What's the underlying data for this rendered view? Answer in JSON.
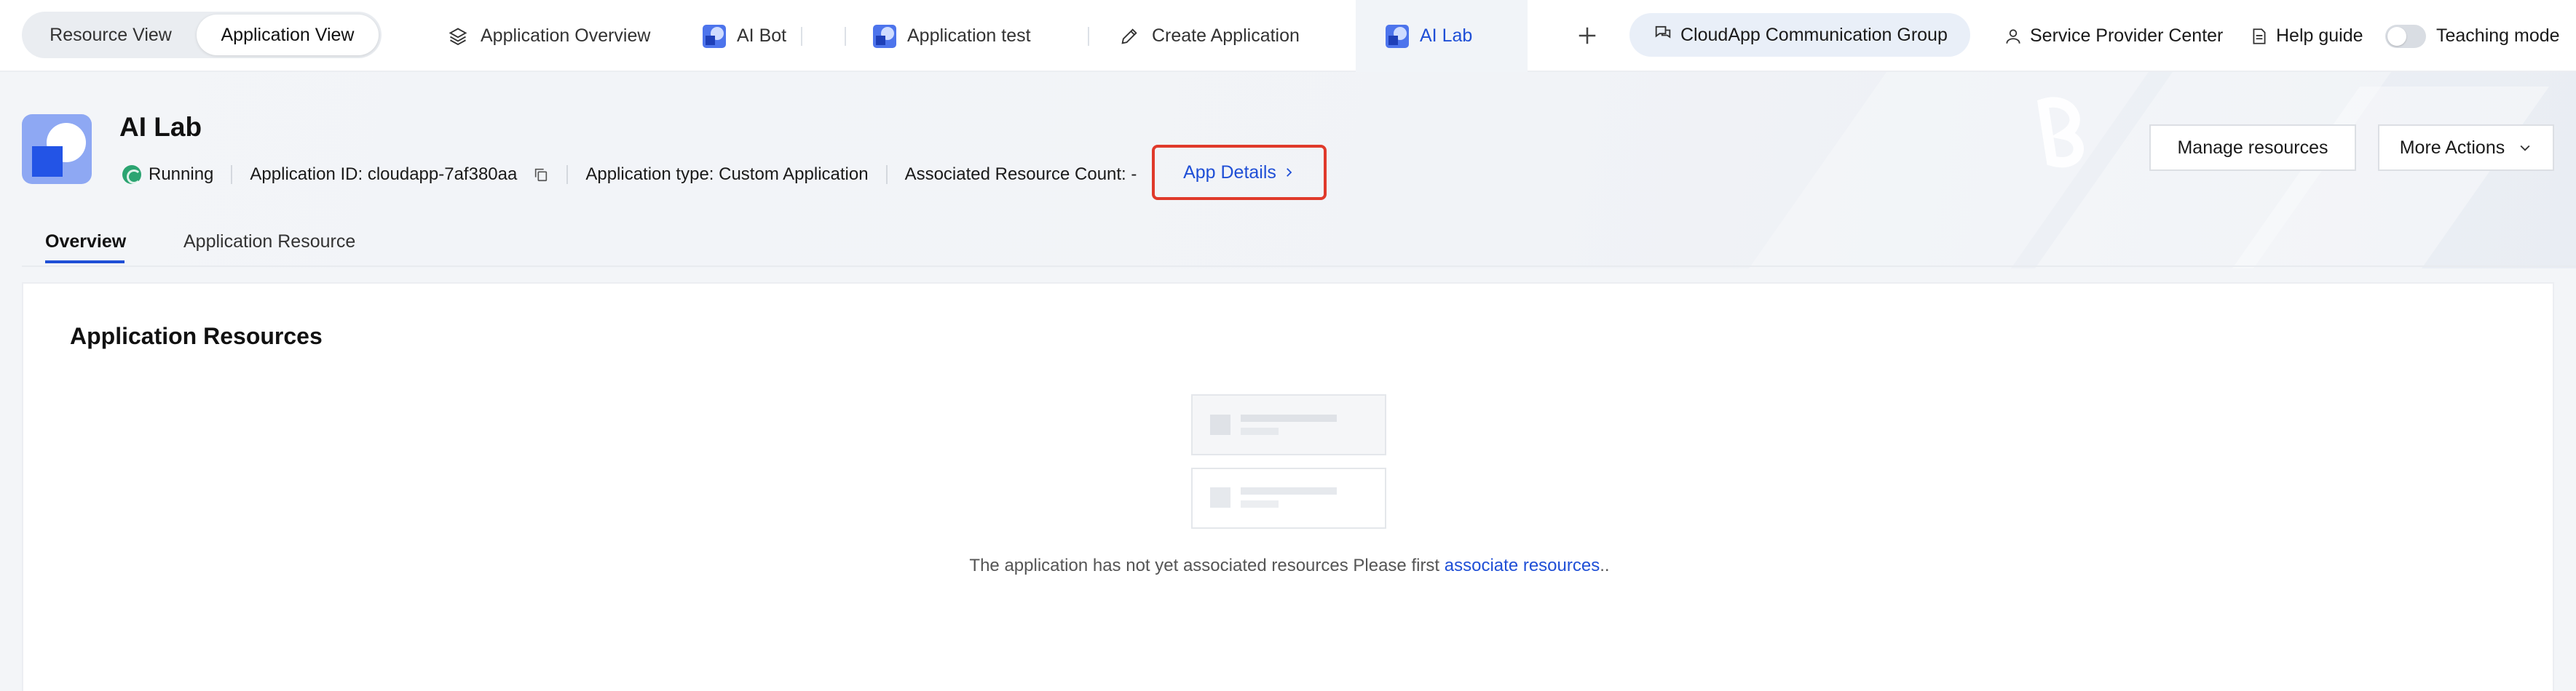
{
  "view_toggle": {
    "resource": "Resource View",
    "application": "Application View"
  },
  "tabs": [
    {
      "label": "Application Overview"
    },
    {
      "label": "AI Bot"
    },
    {
      "label": "Application test"
    },
    {
      "label": "Create Application"
    },
    {
      "label": "AI Lab",
      "active": true
    }
  ],
  "topbar": {
    "group": "CloudApp Communication Group",
    "provider": "Service Provider Center",
    "help": "Help guide",
    "teaching": "Teaching mode"
  },
  "app": {
    "name": "AI Lab",
    "status": "Running",
    "app_id": "Application ID: cloudapp-7af380aa",
    "app_type": "Application type: Custom Application",
    "resource_count": "Associated Resource Count: -",
    "details_link": "App Details"
  },
  "actions": {
    "manage": "Manage resources",
    "more": "More Actions"
  },
  "subtabs": {
    "overview": "Overview",
    "resource": "Application Resource"
  },
  "card": {
    "title": "Application Resources",
    "empty_text": "The application has not yet associated resources Please first ",
    "empty_link": "associate resources",
    "empty_suffix": ".."
  },
  "colors": {
    "accent": "#1f4fd6",
    "running": "#2ba471",
    "highlight_border": "#e03a2b"
  }
}
